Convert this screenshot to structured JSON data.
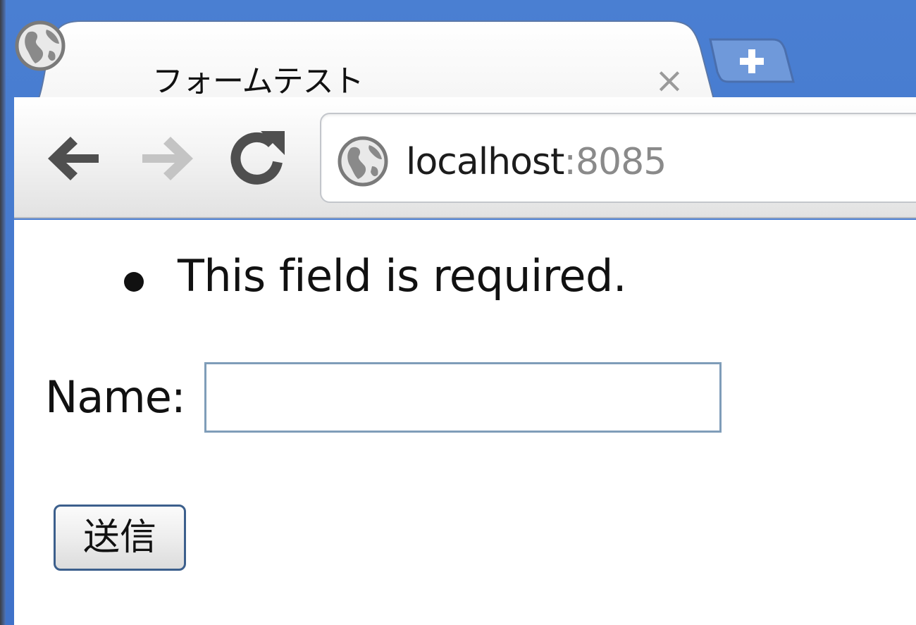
{
  "tab": {
    "title": "フォームテスト",
    "close_glyph": "×",
    "favicon_icon": "globe-icon"
  },
  "toolbar": {
    "back_icon": "arrow-left-icon",
    "forward_icon": "arrow-right-icon",
    "reload_icon": "reload-icon",
    "url_host": "localhost",
    "url_port": ":8085"
  },
  "page": {
    "errors": [
      "This field is required."
    ],
    "name_label": "Name:",
    "name_value": "",
    "submit_label": "送信"
  },
  "colors": {
    "frame_blue": "#4a7fd2",
    "input_border": "#7f9db9",
    "button_border": "#3c5f8c"
  }
}
